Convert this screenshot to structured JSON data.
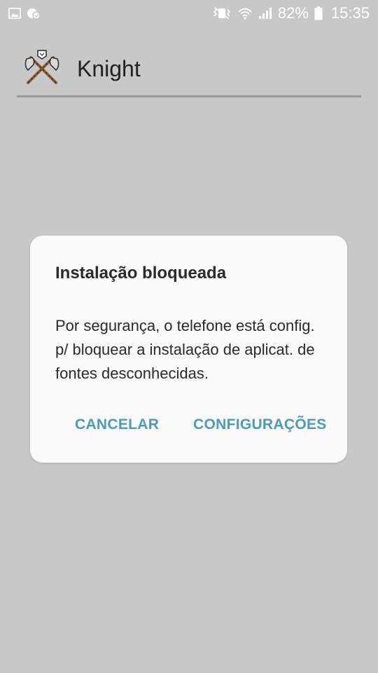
{
  "status_bar": {
    "battery_percent": "82%",
    "time": "15:35",
    "icons": [
      "gallery-icon",
      "notification-icon",
      "vibrate-icon",
      "wifi-icon",
      "signal-icon",
      "battery-icon"
    ]
  },
  "header": {
    "title": "Knight",
    "logo": "crossed-axes-icon"
  },
  "dialog": {
    "title": "Instalação bloqueada",
    "message": "Por segurança, o telefone está config. p/ bloquear a instalação de aplicat. de fontes desconhecidas.",
    "cancel_label": "CANCELAR",
    "settings_label": "CONFIGURAÇÕES",
    "accent_color": "#4a9bbf"
  },
  "colors": {
    "background": "#c8c8c8",
    "dialog_bg": "#fafafa"
  }
}
